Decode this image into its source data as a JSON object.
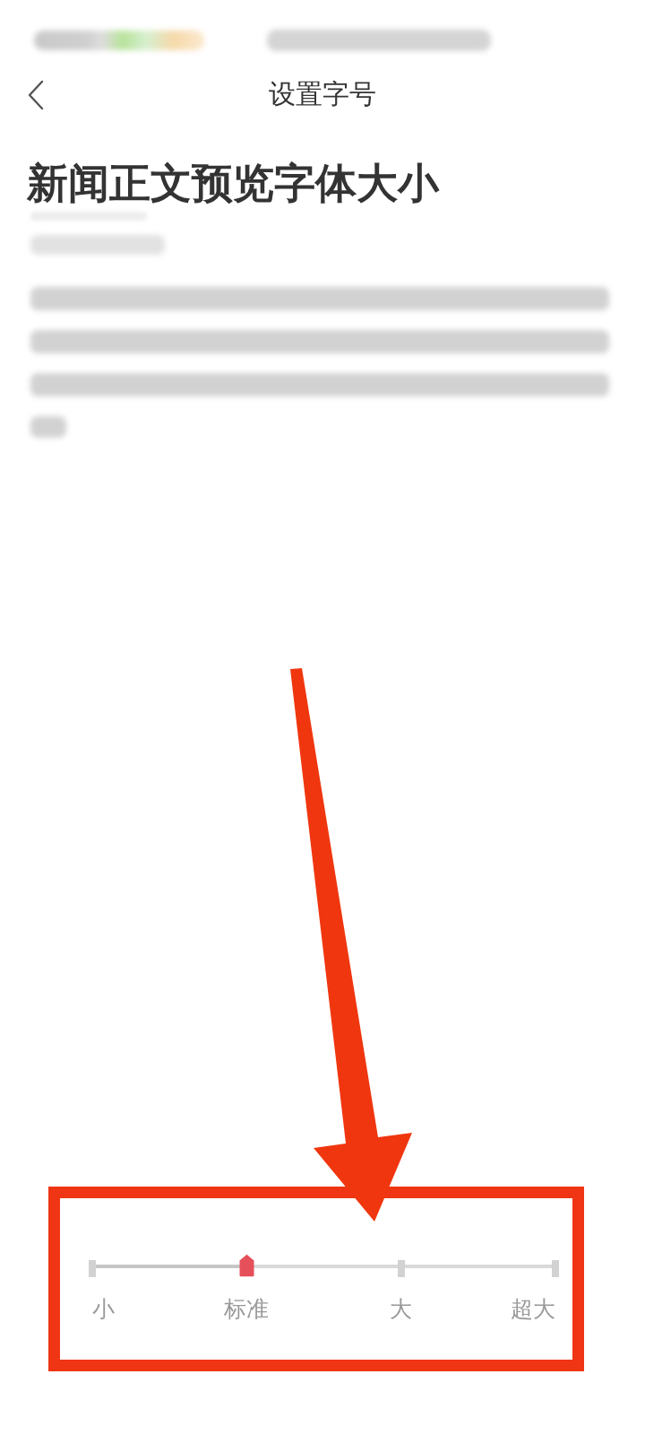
{
  "nav_bar": {
    "title": "设置字号"
  },
  "preview": {
    "heading": "新闻正文预览字体大小"
  },
  "font_size_slider": {
    "options": [
      {
        "label": "小",
        "selected": false
      },
      {
        "label": "标准",
        "selected": true
      },
      {
        "label": "大",
        "selected": false
      },
      {
        "label": "超大",
        "selected": false
      }
    ]
  }
}
